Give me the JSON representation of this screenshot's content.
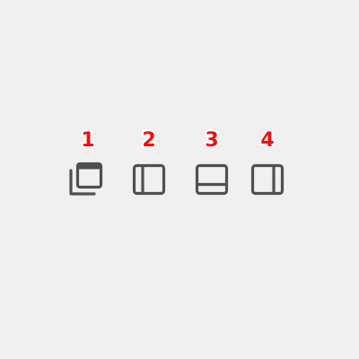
{
  "toolbar": {
    "buttons": [
      {
        "number": "1",
        "icon": "window-stack-icon",
        "color": "#505050"
      },
      {
        "number": "2",
        "icon": "panel-left-icon",
        "color": "#505050"
      },
      {
        "number": "3",
        "icon": "panel-bottom-icon",
        "color": "#505050"
      },
      {
        "number": "4",
        "icon": "panel-right-icon",
        "color": "#505050"
      }
    ]
  },
  "theme": {
    "background": "#f0f0f0",
    "label_color": "#ee1111"
  }
}
